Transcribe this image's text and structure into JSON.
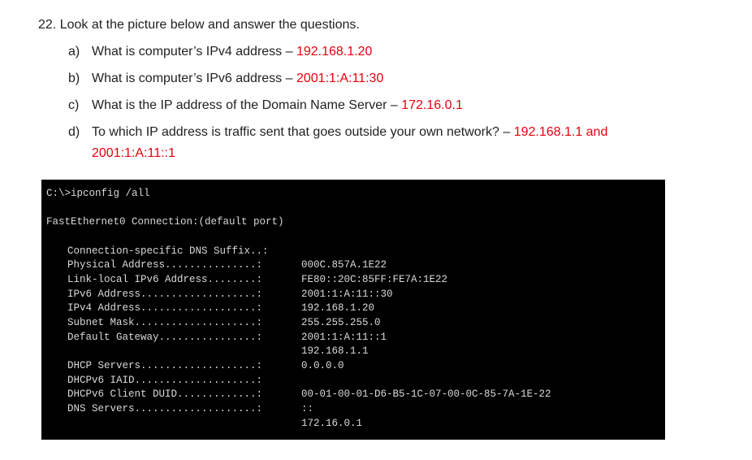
{
  "question": {
    "title": "22. Look at the picture below and answer the questions.",
    "items": [
      {
        "letter": "a)",
        "text": "What is computer’s IPv4 address – ",
        "answer": "192.168.1.20"
      },
      {
        "letter": "b)",
        "text": "What is computer’s IPv6 address  – ",
        "answer": "2001:1:A:11:30"
      },
      {
        "letter": "c)",
        "text": "What is the IP address of the Domain Name Server – ",
        "answer": "172.16.0.1"
      },
      {
        "letter": "d)",
        "text": "To which IP address is traffic sent that goes outside your own network? – ",
        "answer": "192.168.1.1 and",
        "answer_line2": "2001:1:A:11::1"
      }
    ]
  },
  "console": {
    "command": "C:\\>ipconfig /all",
    "adapter": "FastEthernet0 Connection:(default port)",
    "labels": [
      "Connection-specific DNS Suffix..:",
      "Physical Address...............:",
      "Link-local IPv6 Address........:",
      "IPv6 Address...................:",
      "IPv4 Address...................:",
      "Subnet Mask....................:",
      "Default Gateway................:",
      "DHCP Servers...................:",
      "DHCPv6 IAID....................:",
      "DHCPv6 Client DUID.............:",
      "DNS Servers....................:"
    ],
    "values": {
      "physical_address": "000C.857A.1E22",
      "link_local_ipv6": "FE80::20C:85FF:FE7A:1E22",
      "ipv6_address": "2001:1:A:11::30",
      "ipv4_address": "192.168.1.20",
      "subnet_mask": "255.255.255.0",
      "default_gateway_1": "2001:1:A:11::1",
      "default_gateway_2": "192.168.1.1",
      "dhcp_servers": "0.0.0.0",
      "dhcpv6_client_duid": "00-01-00-01-D6-B5-1C-07-00-0C-85-7A-1E-22",
      "dns_servers_1": "::",
      "dns_servers_2": "172.16.0.1"
    }
  }
}
